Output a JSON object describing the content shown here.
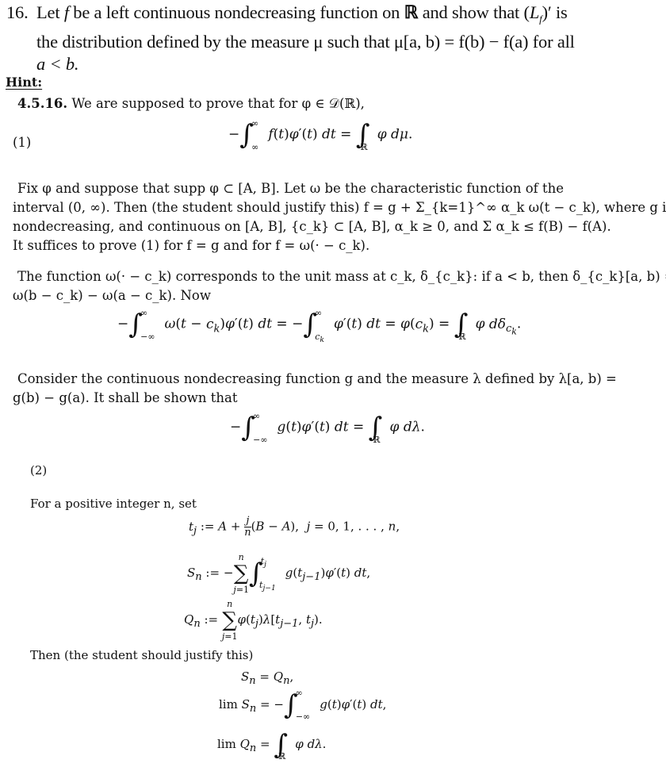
{
  "problem": {
    "number": "16.",
    "line1": "Let f be a left continuous nondecreasing function on ℝ and show that (L_f)′ is",
    "line1_parts": [
      "Let ",
      "f",
      " be a left continuous nondecreasing function on ",
      "ℝ",
      " and show that (",
      "L",
      "f",
      ")′ is"
    ],
    "line2": "the distribution defined by the measure μ such that μ[a, b) = f(b) − f(a) for all",
    "line3": "a < b."
  },
  "hint": {
    "label": "Hint:",
    "ref": "4.5.16.",
    "intro": "We are supposed to prove that for φ ∈ 𝒟(ℝ),",
    "eq1_number": "(1)",
    "eq1": "−∫_∞^∞ f(t)φ′(t) dt = ∫_ℝ φ dμ.",
    "para1": [
      "Fix φ and suppose that supp φ ⊂ [A, B]. Let ω be the characteristic function of the",
      "interval (0, ∞). Then (the student should justify this) f = g + Σ_{k=1}^∞ α_k ω(t − c_k), where g is",
      "nondecreasing, and continuous on [A, B], {c_k} ⊂ [A, B], α_k ≥ 0, and Σ α_k ≤ f(B) − f(A).",
      "It suffices to prove (1) for f = g and for f = ω(· − c_k)."
    ],
    "para2": [
      "The function ω(· − c_k) corresponds to the unit mass at c_k, δ_{c_k}: if a < b, then δ_{c_k}[a, b) =",
      "ω(b − c_k) − ω(a − c_k). Now"
    ],
    "eq_delta": "−∫_{−∞}^∞ ω(t − c_k)φ′(t) dt = −∫_{c_k}^∞ φ′(t) dt = φ(c_k) = ∫_ℝ φ dδ_{c_k}.",
    "para3": [
      "Consider the continuous nondecreasing function g and the measure λ defined by λ[a, b) =",
      "g(b) − g(a). It shall be shown that"
    ],
    "eq2": "−∫_{−∞}^∞ g(t)φ′(t) dt = ∫_ℝ φ dλ.",
    "eq2_number": "(2)",
    "para4": "For a positive integer n, set",
    "defs": {
      "tj": "t_j := A + (j/n)(B − A),  j = 0, 1, . . . , n,",
      "Sn": "S_n := −Σ_{j=1}^n ∫_{t_{j−1}}^{t_j} g(t_{j−1})φ′(t) dt,",
      "Qn": "Q_n := Σ_{j=1}^n φ(t_j)λ[t_{j−1}, t_j)."
    },
    "para5": "Then (the student should justify this)",
    "results": {
      "r1": "S_n = Q_n,",
      "r2": "lim S_n = −∫_{−∞}^∞ g(t)φ′(t) dt,",
      "r3": "lim Q_n = ∫_ℝ φ dλ."
    }
  }
}
